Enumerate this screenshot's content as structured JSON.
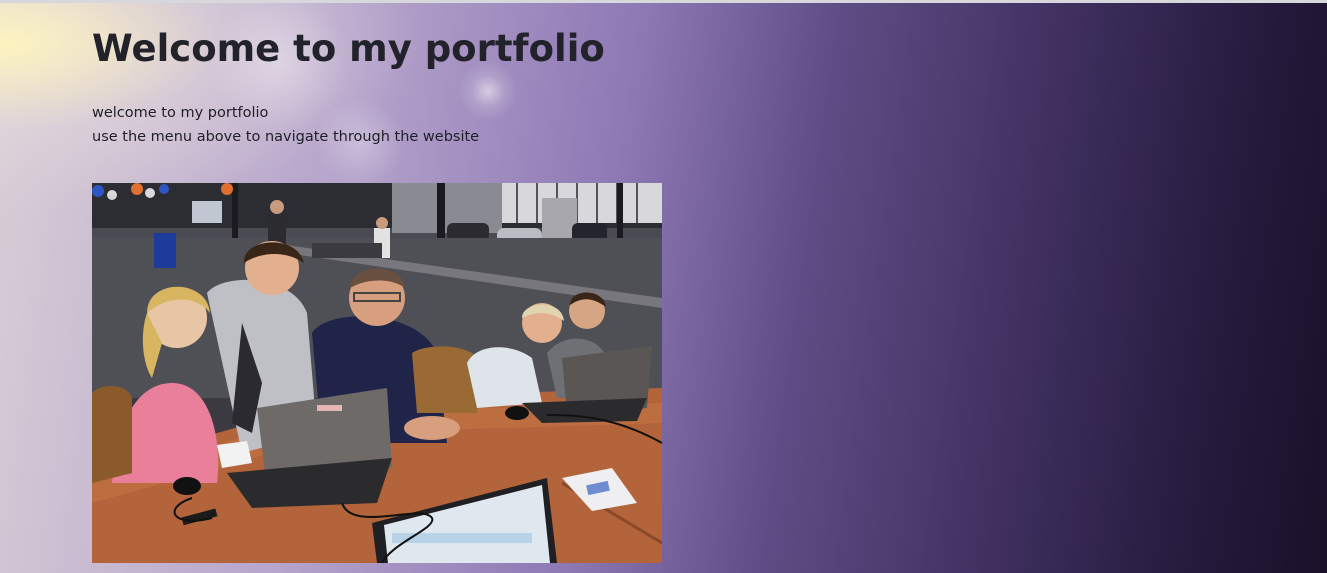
{
  "page": {
    "title": "Welcome to my portfolio",
    "intro_lines": [
      "welcome to my portfolio",
      "use the menu above to navigate through the website"
    ]
  },
  "photo": {
    "icon": "photo-people-at-laptops"
  },
  "colors": {
    "title": "#22222a",
    "text": "#1f1f26",
    "background_left": "#f7ecc8",
    "background_mid": "#8d78b4",
    "background_right": "#1a1029"
  }
}
